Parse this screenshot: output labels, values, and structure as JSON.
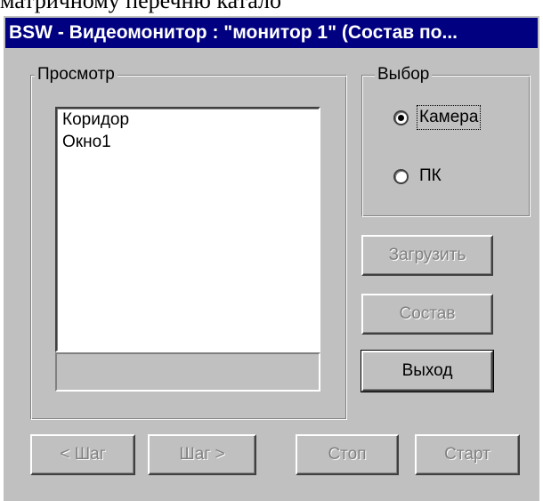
{
  "document_text": "матричному перечню катало",
  "window": {
    "title": "BSW - Видеомонитор : \"монитор 1\" (Состав по..."
  },
  "view_group": {
    "label": "Просмотр",
    "list_items": [
      "Коридор",
      "Окно1"
    ],
    "status_text": ""
  },
  "choice_group": {
    "label": "Выбор",
    "options": [
      {
        "label": "Камера",
        "selected": true
      },
      {
        "label": "ПК",
        "selected": false
      }
    ]
  },
  "buttons": {
    "load": "Загрузить",
    "compose": "Состав",
    "exit": "Выход",
    "step_back": "< Шаг",
    "step_forward": "Шаг >",
    "stop": "Стоп",
    "start": "Старт"
  }
}
